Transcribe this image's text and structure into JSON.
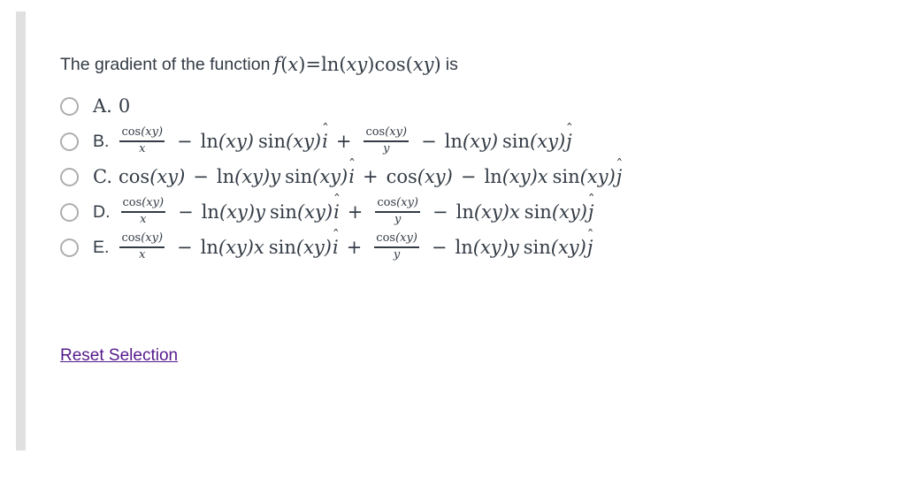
{
  "page": {
    "background_color": "#ffffff",
    "text_color": "#333b45",
    "link_color": "#551a8b",
    "radio_border_color": "#adadad",
    "rail_color": "#e0e0e0"
  },
  "question": {
    "prefix": "The gradient of the function",
    "function_label": "f",
    "function_arg_open": "(",
    "function_var": "x",
    "function_arg_close": ")",
    "equals": "=",
    "ln": "ln",
    "paren_open": "(",
    "xy": "xy",
    "paren_close": ")",
    "cos": "cos",
    "suffix": "is",
    "full_text": "The gradient of the function f(x) = ln(xy) cos(xy) is"
  },
  "symbols": {
    "ln": "ln",
    "cos": "cos",
    "sin": "sin",
    "minus": "−",
    "plus": "+",
    "open": "(",
    "close": ")",
    "xy": "xy",
    "x": "x",
    "y": "y",
    "i_hat_base": "i",
    "j_hat_base": "j",
    "hat": "ˆ"
  },
  "options": [
    {
      "letter": "A.",
      "selected": false,
      "kind": "plain",
      "text": "0",
      "full_text": "0"
    },
    {
      "letter": "B.",
      "selected": false,
      "kind": "math",
      "full_text": "cos(xy)/x − ln(xy) sin(xy) î + cos(xy)/y − ln(xy) sin(xy) ĵ",
      "term_i": {
        "frac_num_cos": "cos",
        "frac_num_arg": "(xy)",
        "frac_den": "x",
        "minus": "−",
        "ln": "ln",
        "ln_arg": "(xy)",
        "sin": "sin",
        "sin_factor": "",
        "sin_arg": "(xy)",
        "unit": "i"
      },
      "term_j": {
        "frac_num_cos": "cos",
        "frac_num_arg": "(xy)",
        "frac_den": "y",
        "minus": "−",
        "ln": "ln",
        "ln_arg": "(xy)",
        "sin": "sin",
        "sin_factor": "",
        "sin_arg": "(xy)",
        "unit": "j"
      }
    },
    {
      "letter": "C.",
      "selected": false,
      "kind": "math-nofrac",
      "full_text": "cos(xy) − ln(xy)y sin(xy) î + cos(xy) − ln(xy)x sin(xy) ĵ",
      "term_i": {
        "cos": "cos",
        "cos_arg": "(xy)",
        "minus": "−",
        "ln": "ln",
        "ln_arg": "(xy)",
        "factor": "y",
        "sin": "sin",
        "sin_arg": "(xy)",
        "unit": "i"
      },
      "term_j": {
        "cos": "cos",
        "cos_arg": "(xy)",
        "minus": "−",
        "ln": "ln",
        "ln_arg": "(xy)",
        "factor": "x",
        "sin": "sin",
        "sin_arg": "(xy)",
        "unit": "j"
      }
    },
    {
      "letter": "D.",
      "selected": false,
      "kind": "math",
      "full_text": "cos(xy)/x − ln(xy)y sin(xy) î + cos(xy)/y − ln(xy)x sin(xy) ĵ",
      "term_i": {
        "frac_num_cos": "cos",
        "frac_num_arg": "(xy)",
        "frac_den": "x",
        "minus": "−",
        "ln": "ln",
        "ln_arg": "(xy)",
        "sin": "sin",
        "sin_factor": "y",
        "sin_arg": "(xy)",
        "unit": "i"
      },
      "term_j": {
        "frac_num_cos": "cos",
        "frac_num_arg": "(xy)",
        "frac_den": "y",
        "minus": "−",
        "ln": "ln",
        "ln_arg": "(xy)",
        "sin": "sin",
        "sin_factor": "x",
        "sin_arg": "(xy)",
        "unit": "j"
      }
    },
    {
      "letter": "E.",
      "selected": false,
      "kind": "math",
      "full_text": "cos(xy)/x − ln(xy)x sin(xy) î + cos(xy)/y − ln(xy)y sin(xy) ĵ",
      "term_i": {
        "frac_num_cos": "cos",
        "frac_num_arg": "(xy)",
        "frac_den": "x",
        "minus": "−",
        "ln": "ln",
        "ln_arg": "(xy)",
        "sin": "sin",
        "sin_factor": "x",
        "sin_arg": "(xy)",
        "unit": "i"
      },
      "term_j": {
        "frac_num_cos": "cos",
        "frac_num_arg": "(xy)",
        "frac_den": "y",
        "minus": "−",
        "ln": "ln",
        "ln_arg": "(xy)",
        "sin": "sin",
        "sin_factor": "y",
        "sin_arg": "(xy)",
        "unit": "j"
      }
    }
  ],
  "reset": {
    "label": "Reset Selection"
  }
}
